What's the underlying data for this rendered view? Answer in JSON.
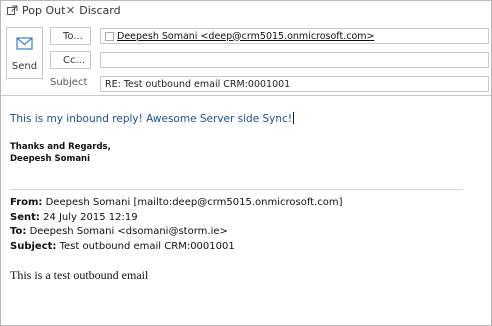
{
  "toolbar": {
    "pop_out_label": "Pop Out",
    "discard_label": "Discard"
  },
  "send": {
    "label": "Send"
  },
  "header": {
    "to_label": "To...",
    "cc_label": "Cc...",
    "subject_label": "Subject",
    "to_recipient": "Deepesh Somani <deep@crm5015.onmicrosoft.com>",
    "cc_value": "",
    "subject_value": "RE: Test outbound email CRM:0001001"
  },
  "body": {
    "reply_text": "This is my inbound reply! Awesome Server side Sync!",
    "signature_line1": "Thanks and Regards,",
    "signature_line2": "Deepesh Somani",
    "quoted": {
      "from_label": "From:",
      "from_value": "Deepesh Somani [mailto:deep@crm5015.onmicrosoft.com]",
      "sent_label": "Sent:",
      "sent_value": "24 July 2015 12:19",
      "to_label": "To:",
      "to_value": "Deepesh Somani <dsomani@storm.ie>",
      "subject_label": "Subject:",
      "subject_value": "Test outbound email CRM:0001001"
    },
    "original_text": "This is a test outbound email"
  },
  "colors": {
    "reply_text": "#1f4f8a",
    "border": "#c8c8c8",
    "send_icon": "#3b7fc4"
  },
  "icons": {
    "pop_out": "pop-out-icon",
    "discard": "discard-icon",
    "send": "send-icon"
  }
}
